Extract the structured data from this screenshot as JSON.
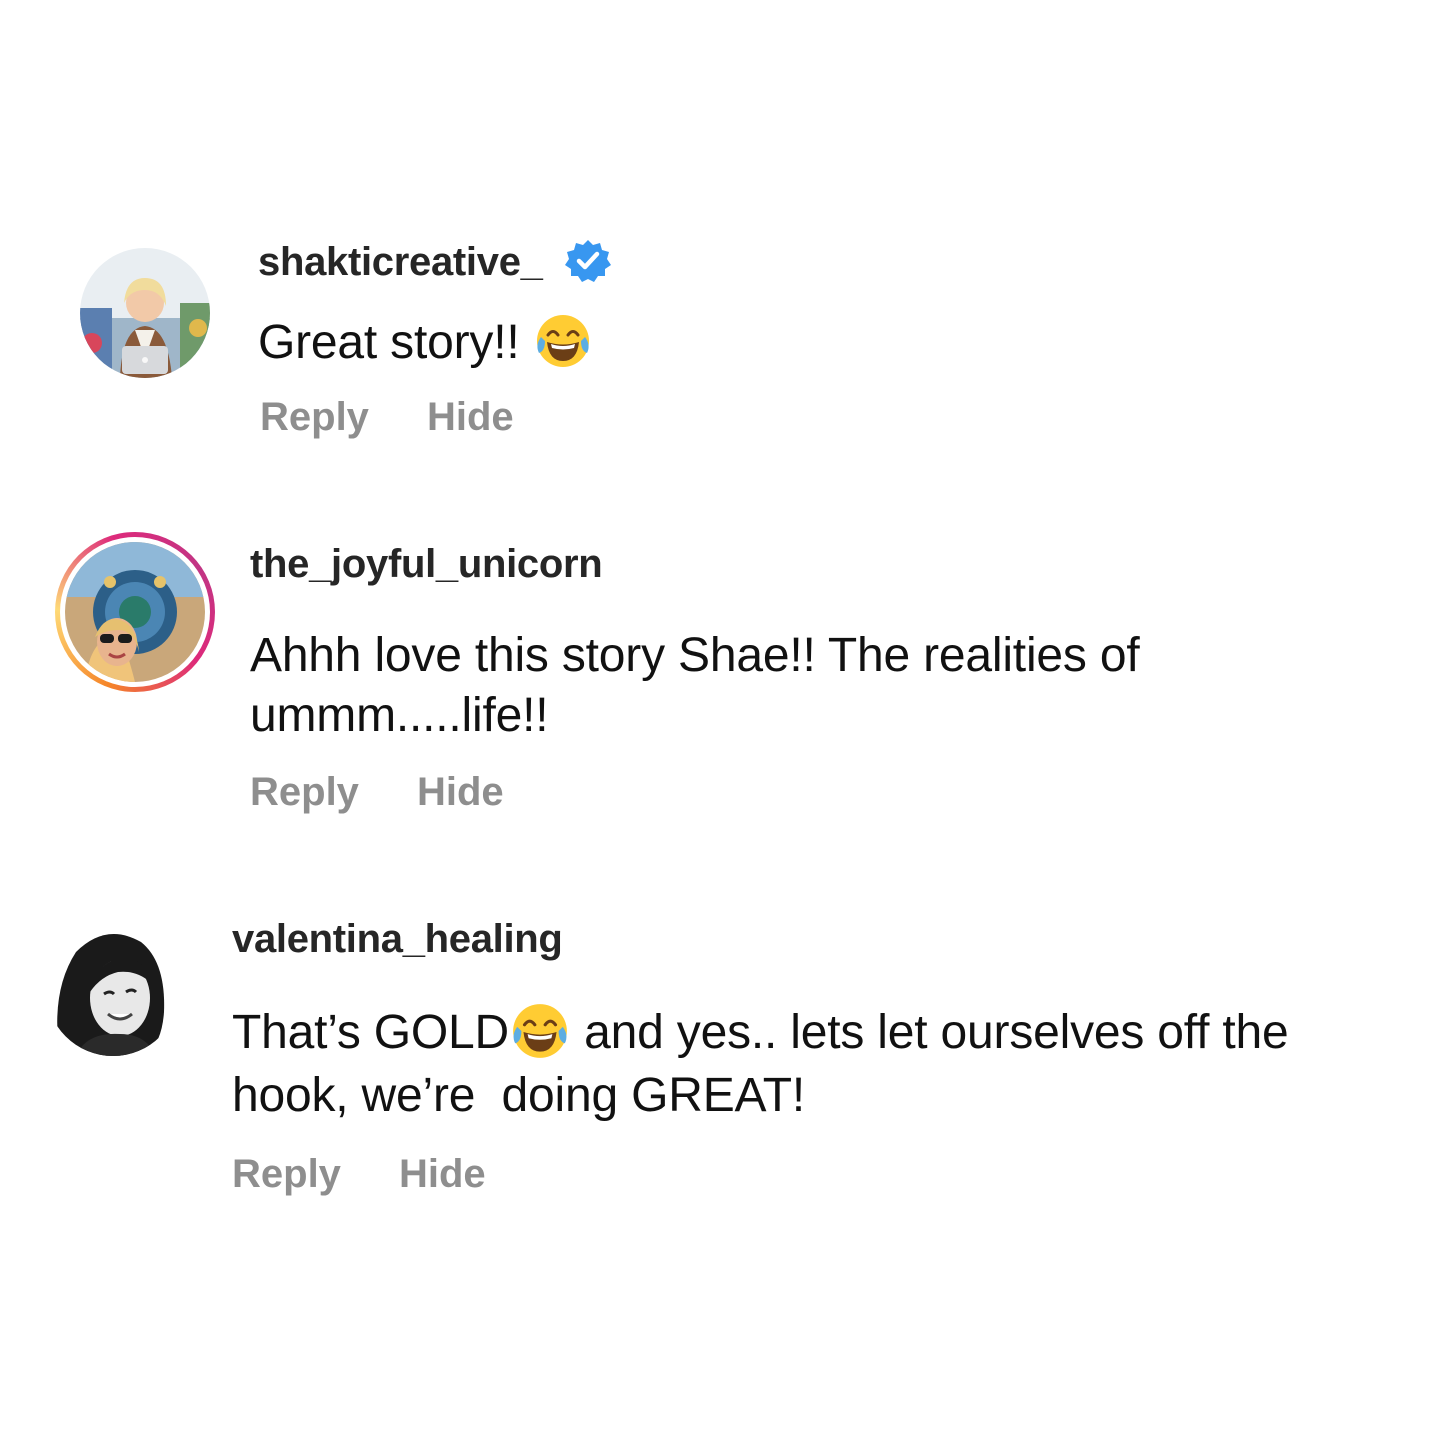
{
  "colors": {
    "username": "#262626",
    "text": "#111111",
    "action": "#8e8e8e",
    "verified": "#3897f0",
    "story_ring_start": "#f58529",
    "story_ring_end": "#c13584"
  },
  "comments": [
    {
      "username": "shakticreative_",
      "verified": true,
      "verified_icon": "verified-badge-icon",
      "text_before_emoji": "Great story!! ",
      "emoji": "face-with-tears-of-joy-icon",
      "text_after_emoji": "",
      "reply_label": "Reply",
      "hide_label": "Hide"
    },
    {
      "username": "the_joyful_unicorn",
      "has_story_ring": true,
      "text_line1": "Ahhh love this story Shae!! The realities of",
      "text_line2": "ummm.....life!!",
      "reply_label": "Reply",
      "hide_label": "Hide"
    },
    {
      "username": "valentina_healing",
      "text_before_emoji": "That’s GOLD",
      "emoji": "face-with-tears-of-joy-icon",
      "text_after_emoji_line1": " and yes.. lets let ourselves off the",
      "text_line2": "hook, we’re  doing GREAT!",
      "reply_label": "Reply",
      "hide_label": "Hide"
    }
  ]
}
